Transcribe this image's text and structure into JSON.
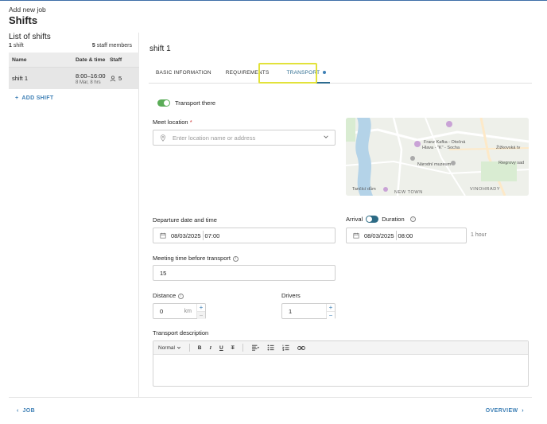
{
  "header": {
    "breadcrumb": "Add new job",
    "title": "Shifts"
  },
  "shifts_panel": {
    "title": "List of shifts",
    "shift_count": "1",
    "shift_count_label": "shift",
    "staff_count": "5",
    "staff_count_label": "staff members",
    "columns": [
      "Name",
      "Date & time",
      "Staff"
    ],
    "rows": [
      {
        "name": "shift 1",
        "time": "8:00–16:00",
        "date": "8 Mar, 8 hrs",
        "staff": "5"
      }
    ],
    "add_label": "ADD SHIFT"
  },
  "main": {
    "shift_title": "shift 1",
    "tabs": [
      "BASIC INFORMATION",
      "REQUIREMENTS",
      "TRANSPORT"
    ],
    "transport_toggle_label": "Transport there",
    "meet_location": {
      "label": "Meet location",
      "required_mark": "*",
      "placeholder": "Enter location name or address"
    },
    "map": {
      "labels": [
        "Franz Kafka - Otočná",
        "Hlava - \"K\" - Socha",
        "Žižkovská tv",
        "Národní muzeum",
        "Riegrovy sad",
        "Tančící dům",
        "NEW TOWN",
        "VINOHRADY"
      ]
    },
    "departure": {
      "label": "Departure date and time",
      "date": "08/03/2025",
      "time": "07:00"
    },
    "arrival": {
      "label_arrival": "Arrival",
      "label_duration": "Duration",
      "date": "08/03/2025",
      "time": "08:00",
      "duration_hint": "1 hour"
    },
    "meeting_time": {
      "label": "Meeting time before transport",
      "value": "15"
    },
    "distance": {
      "label": "Distance",
      "value": "0",
      "unit": "km",
      "plus": "+",
      "minus": "−"
    },
    "drivers": {
      "label": "Drivers",
      "value": "1",
      "plus": "+",
      "minus": "−"
    },
    "description": {
      "label": "Transport description",
      "format_label": "Normal"
    }
  },
  "footer": {
    "back_label": "JOB",
    "next_label": "OVERVIEW"
  },
  "colors": {
    "accent": "#3d7fb5",
    "tab_active": "#2c6b8f",
    "toggle_on": "#5aac57",
    "highlight": "#e2e23a"
  }
}
